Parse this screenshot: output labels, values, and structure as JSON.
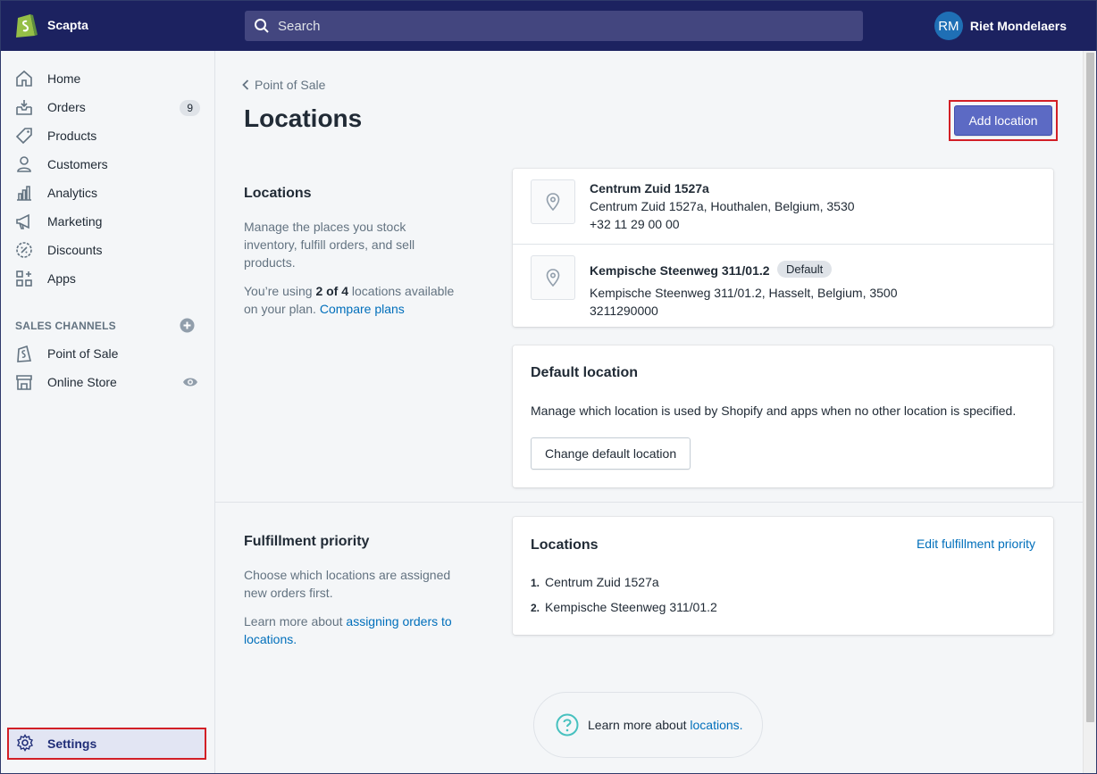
{
  "topbar": {
    "store_name": "Scapta",
    "search_placeholder": "Search",
    "user_initials": "RM",
    "user_name": "Riet Mondelaers"
  },
  "sidebar": {
    "items": [
      {
        "label": "Home",
        "icon": "home-icon"
      },
      {
        "label": "Orders",
        "icon": "orders-icon",
        "badge": "9"
      },
      {
        "label": "Products",
        "icon": "tag-icon"
      },
      {
        "label": "Customers",
        "icon": "customer-icon"
      },
      {
        "label": "Analytics",
        "icon": "analytics-icon"
      },
      {
        "label": "Marketing",
        "icon": "megaphone-icon"
      },
      {
        "label": "Discounts",
        "icon": "discount-icon"
      },
      {
        "label": "Apps",
        "icon": "apps-icon"
      }
    ],
    "sales_channels_title": "SALES CHANNELS",
    "channels": [
      {
        "label": "Point of Sale",
        "icon": "pos-icon"
      },
      {
        "label": "Online Store",
        "icon": "store-icon"
      }
    ],
    "settings_label": "Settings"
  },
  "main": {
    "breadcrumb": "Point of Sale",
    "title": "Locations",
    "add_button": "Add location",
    "locations_section": {
      "heading": "Locations",
      "desc": "Manage the places you stock inventory, fulfill orders, and sell products.",
      "usage_prefix": "You’re using ",
      "usage_bold": "2 of 4",
      "usage_suffix": " locations available on your plan. ",
      "usage_link": "Compare plans"
    },
    "locations": [
      {
        "name": "Centrum Zuid 1527a",
        "address": "Centrum Zuid 1527a, Houthalen, Belgium, 3530",
        "phone": "+32 11 29 00 00"
      },
      {
        "name": "Kempische Steenweg 311/01.2",
        "badge": "Default",
        "address": "Kempische Steenweg 311/01.2, Hasselt, Belgium, 3500",
        "phone": "3211290000"
      }
    ],
    "default_location": {
      "heading": "Default location",
      "text": "Manage which location is used by Shopify and apps when no other location is specified.",
      "button": "Change default location"
    },
    "fulfillment": {
      "heading": "Fulfillment priority",
      "desc": "Choose which locations are assigned new orders first.",
      "learn_prefix": "Learn more about ",
      "learn_link": "assigning orders to locations",
      "learn_suffix": ".",
      "card_heading": "Locations",
      "edit_link": "Edit fulfillment priority",
      "list": [
        {
          "num": "1.",
          "name": "Centrum Zuid 1527a"
        },
        {
          "num": "2.",
          "name": "Kempische Steenweg 311/01.2"
        }
      ]
    },
    "help": {
      "prefix": "Learn more about ",
      "link": "locations",
      "suffix": "."
    }
  },
  "colors": {
    "topbar": "#1c2260",
    "accent": "#5c6ac4",
    "link": "#006fbb",
    "highlight": "#d21f26"
  }
}
